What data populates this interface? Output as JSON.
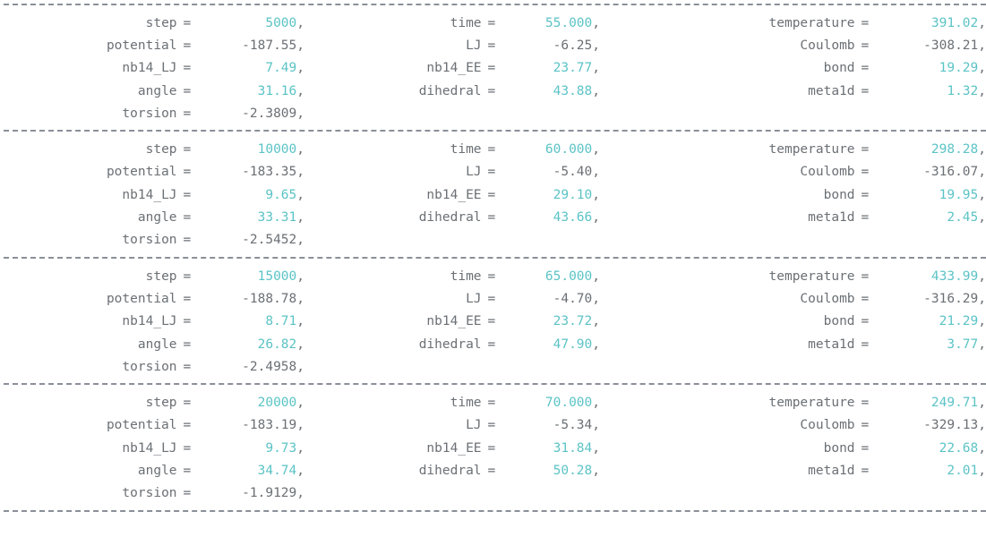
{
  "console": {
    "kind": "terminal-output",
    "separator_char": "-",
    "colors": {
      "background": "#ffffff",
      "label": "#6b7075",
      "value_positive": "#5cc3c6",
      "value_negative": "#6b7075",
      "separator": "#8a8f98"
    }
  },
  "blocks": [
    {
      "rows": [
        [
          {
            "label": "step",
            "eq": "=",
            "value": "5000",
            "comma": ",",
            "negative": false
          },
          {
            "label": "time",
            "eq": "=",
            "value": "55.000",
            "comma": ",",
            "negative": false
          },
          {
            "label": "temperature",
            "eq": "=",
            "value": "391.02",
            "comma": ",",
            "negative": false
          }
        ],
        [
          {
            "label": "potential",
            "eq": "=",
            "value": "-187.55",
            "comma": ",",
            "negative": true
          },
          {
            "label": "LJ",
            "eq": "=",
            "value": "-6.25",
            "comma": ",",
            "negative": true
          },
          {
            "label": "Coulomb",
            "eq": "=",
            "value": "-308.21",
            "comma": ",",
            "negative": true
          }
        ],
        [
          {
            "label": "nb14_LJ",
            "eq": "=",
            "value": "7.49",
            "comma": ",",
            "negative": false
          },
          {
            "label": "nb14_EE",
            "eq": "=",
            "value": "23.77",
            "comma": ",",
            "negative": false
          },
          {
            "label": "bond",
            "eq": "=",
            "value": "19.29",
            "comma": ",",
            "negative": false
          }
        ],
        [
          {
            "label": "angle",
            "eq": "=",
            "value": "31.16",
            "comma": ",",
            "negative": false
          },
          {
            "label": "dihedral",
            "eq": "=",
            "value": "43.88",
            "comma": ",",
            "negative": false
          },
          {
            "label": "meta1d",
            "eq": "=",
            "value": "1.32",
            "comma": ",",
            "negative": false
          }
        ],
        [
          {
            "label": "torsion",
            "eq": "=",
            "value": "-2.3809",
            "comma": ",",
            "negative": true
          },
          null,
          null
        ]
      ]
    },
    {
      "rows": [
        [
          {
            "label": "step",
            "eq": "=",
            "value": "10000",
            "comma": ",",
            "negative": false
          },
          {
            "label": "time",
            "eq": "=",
            "value": "60.000",
            "comma": ",",
            "negative": false
          },
          {
            "label": "temperature",
            "eq": "=",
            "value": "298.28",
            "comma": ",",
            "negative": false
          }
        ],
        [
          {
            "label": "potential",
            "eq": "=",
            "value": "-183.35",
            "comma": ",",
            "negative": true
          },
          {
            "label": "LJ",
            "eq": "=",
            "value": "-5.40",
            "comma": ",",
            "negative": true
          },
          {
            "label": "Coulomb",
            "eq": "=",
            "value": "-316.07",
            "comma": ",",
            "negative": true
          }
        ],
        [
          {
            "label": "nb14_LJ",
            "eq": "=",
            "value": "9.65",
            "comma": ",",
            "negative": false
          },
          {
            "label": "nb14_EE",
            "eq": "=",
            "value": "29.10",
            "comma": ",",
            "negative": false
          },
          {
            "label": "bond",
            "eq": "=",
            "value": "19.95",
            "comma": ",",
            "negative": false
          }
        ],
        [
          {
            "label": "angle",
            "eq": "=",
            "value": "33.31",
            "comma": ",",
            "negative": false
          },
          {
            "label": "dihedral",
            "eq": "=",
            "value": "43.66",
            "comma": ",",
            "negative": false
          },
          {
            "label": "meta1d",
            "eq": "=",
            "value": "2.45",
            "comma": ",",
            "negative": false
          }
        ],
        [
          {
            "label": "torsion",
            "eq": "=",
            "value": "-2.5452",
            "comma": ",",
            "negative": true
          },
          null,
          null
        ]
      ]
    },
    {
      "rows": [
        [
          {
            "label": "step",
            "eq": "=",
            "value": "15000",
            "comma": ",",
            "negative": false
          },
          {
            "label": "time",
            "eq": "=",
            "value": "65.000",
            "comma": ",",
            "negative": false
          },
          {
            "label": "temperature",
            "eq": "=",
            "value": "433.99",
            "comma": ",",
            "negative": false
          }
        ],
        [
          {
            "label": "potential",
            "eq": "=",
            "value": "-188.78",
            "comma": ",",
            "negative": true
          },
          {
            "label": "LJ",
            "eq": "=",
            "value": "-4.70",
            "comma": ",",
            "negative": true
          },
          {
            "label": "Coulomb",
            "eq": "=",
            "value": "-316.29",
            "comma": ",",
            "negative": true
          }
        ],
        [
          {
            "label": "nb14_LJ",
            "eq": "=",
            "value": "8.71",
            "comma": ",",
            "negative": false
          },
          {
            "label": "nb14_EE",
            "eq": "=",
            "value": "23.72",
            "comma": ",",
            "negative": false
          },
          {
            "label": "bond",
            "eq": "=",
            "value": "21.29",
            "comma": ",",
            "negative": false
          }
        ],
        [
          {
            "label": "angle",
            "eq": "=",
            "value": "26.82",
            "comma": ",",
            "negative": false
          },
          {
            "label": "dihedral",
            "eq": "=",
            "value": "47.90",
            "comma": ",",
            "negative": false
          },
          {
            "label": "meta1d",
            "eq": "=",
            "value": "3.77",
            "comma": ",",
            "negative": false
          }
        ],
        [
          {
            "label": "torsion",
            "eq": "=",
            "value": "-2.4958",
            "comma": ",",
            "negative": true
          },
          null,
          null
        ]
      ]
    },
    {
      "rows": [
        [
          {
            "label": "step",
            "eq": "=",
            "value": "20000",
            "comma": ",",
            "negative": false
          },
          {
            "label": "time",
            "eq": "=",
            "value": "70.000",
            "comma": ",",
            "negative": false
          },
          {
            "label": "temperature",
            "eq": "=",
            "value": "249.71",
            "comma": ",",
            "negative": false
          }
        ],
        [
          {
            "label": "potential",
            "eq": "=",
            "value": "-183.19",
            "comma": ",",
            "negative": true
          },
          {
            "label": "LJ",
            "eq": "=",
            "value": "-5.34",
            "comma": ",",
            "negative": true
          },
          {
            "label": "Coulomb",
            "eq": "=",
            "value": "-329.13",
            "comma": ",",
            "negative": true
          }
        ],
        [
          {
            "label": "nb14_LJ",
            "eq": "=",
            "value": "9.73",
            "comma": ",",
            "negative": false
          },
          {
            "label": "nb14_EE",
            "eq": "=",
            "value": "31.84",
            "comma": ",",
            "negative": false
          },
          {
            "label": "bond",
            "eq": "=",
            "value": "22.68",
            "comma": ",",
            "negative": false
          }
        ],
        [
          {
            "label": "angle",
            "eq": "=",
            "value": "34.74",
            "comma": ",",
            "negative": false
          },
          {
            "label": "dihedral",
            "eq": "=",
            "value": "50.28",
            "comma": ",",
            "negative": false
          },
          {
            "label": "meta1d",
            "eq": "=",
            "value": "2.01",
            "comma": ",",
            "negative": false
          }
        ],
        [
          {
            "label": "torsion",
            "eq": "=",
            "value": "-1.9129",
            "comma": ",",
            "negative": true
          },
          null,
          null
        ]
      ]
    }
  ]
}
